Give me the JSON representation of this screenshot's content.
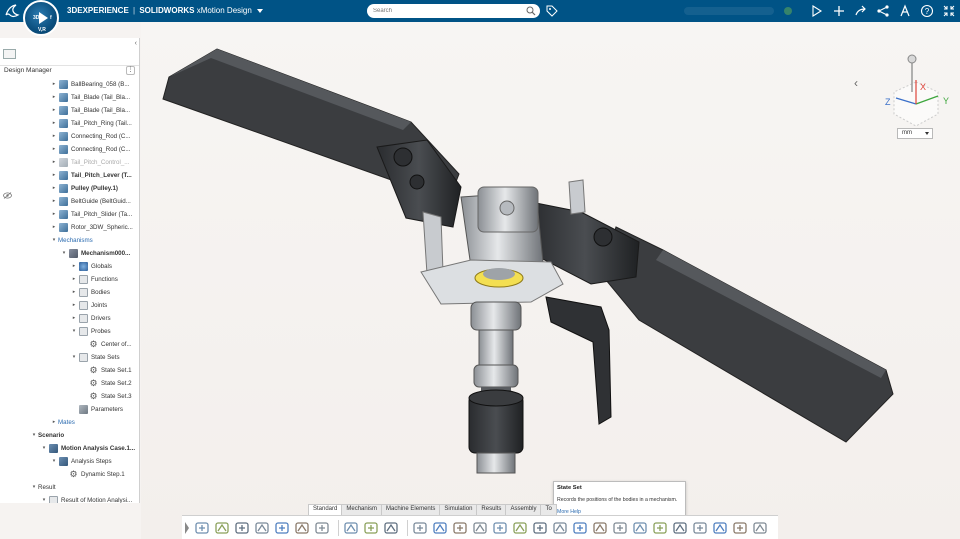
{
  "topbar": {
    "brand_logo": "3ds-logo-icon",
    "compass_play": "play-icon",
    "compass_top": "3D",
    "compass_side": "f",
    "compass_version": "V,R",
    "brand": "3DEXPERIENCE",
    "separator": "|",
    "product": "SOLIDWORKS",
    "app": "xMotion Design",
    "search_placeholder": "Search",
    "icons": [
      "search-icon",
      "tag-icon",
      "share-icon",
      "add-icon",
      "forward-icon",
      "network-icon",
      "compass-tools-icon",
      "help-icon",
      "close-fullscreen-icon"
    ]
  },
  "left_panel": {
    "title": "Design Manager",
    "collapse": "‹",
    "more": "⋮",
    "tree": [
      {
        "label": "BallBearing_058 (B...",
        "indent": 0,
        "icon": "part",
        "arrow": "▸",
        "style": "normal"
      },
      {
        "label": "Tail_Blade (Tail_Bla...",
        "indent": 0,
        "icon": "part",
        "arrow": "▸",
        "style": "normal"
      },
      {
        "label": "Tail_Blade (Tail_Bla...",
        "indent": 0,
        "icon": "part",
        "arrow": "▸",
        "style": "normal"
      },
      {
        "label": "Tail_Pitch_Ring (Tail...",
        "indent": 0,
        "icon": "part",
        "arrow": "▸",
        "style": "normal"
      },
      {
        "label": "Connecting_Rod (C...",
        "indent": 0,
        "icon": "part",
        "arrow": "▸",
        "style": "normal"
      },
      {
        "label": "Connecting_Rod (C...",
        "indent": 0,
        "icon": "part",
        "arrow": "▸",
        "style": "normal"
      },
      {
        "label": "Tail_Pitch_Control_...",
        "indent": 0,
        "icon": "part-grey",
        "arrow": "▸",
        "style": "grey"
      },
      {
        "label": "Tail_Pitch_Lever (T...",
        "indent": 0,
        "icon": "part",
        "arrow": "▸",
        "style": "bold"
      },
      {
        "label": "Pulley (Pulley.1)",
        "indent": 0,
        "icon": "part",
        "arrow": "▸",
        "style": "bold"
      },
      {
        "label": "BeltGuide (BeltGuid...",
        "indent": 0,
        "icon": "part",
        "arrow": "▸",
        "style": "normal"
      },
      {
        "label": "Tail_Pitch_Slider (Ta...",
        "indent": 0,
        "icon": "part",
        "arrow": "▸",
        "style": "normal"
      },
      {
        "label": "Rotor_3DW_Spheric...",
        "indent": 0,
        "icon": "part",
        "arrow": "▸",
        "style": "normal"
      },
      {
        "label": "Mechanisms",
        "indent": 0,
        "icon": "none",
        "arrow": "▾",
        "style": "blue"
      },
      {
        "label": "Mechanism000...",
        "indent": 1,
        "icon": "mech",
        "arrow": "▾",
        "style": "bold"
      },
      {
        "label": "Globals",
        "indent": 2,
        "icon": "globe",
        "arrow": "▸",
        "style": "normal"
      },
      {
        "label": "Functions",
        "indent": 2,
        "icon": "folder",
        "arrow": "▸",
        "style": "normal"
      },
      {
        "label": "Bodies",
        "indent": 2,
        "icon": "folder",
        "arrow": "▸",
        "style": "normal"
      },
      {
        "label": "Joints",
        "indent": 2,
        "icon": "folder",
        "arrow": "▸",
        "style": "normal"
      },
      {
        "label": "Drivers",
        "indent": 2,
        "icon": "folder",
        "arrow": "▸",
        "style": "normal"
      },
      {
        "label": "Probes",
        "indent": 2,
        "icon": "folder",
        "arrow": "▾",
        "style": "normal"
      },
      {
        "label": "Center of...",
        "indent": 3,
        "icon": "state",
        "arrow": "",
        "style": "normal"
      },
      {
        "label": "State Sets",
        "indent": 2,
        "icon": "folder",
        "arrow": "▾",
        "style": "normal"
      },
      {
        "label": "State Set.1",
        "indent": 3,
        "icon": "state",
        "arrow": "",
        "style": "normal"
      },
      {
        "label": "State Set.2",
        "indent": 3,
        "icon": "state",
        "arrow": "",
        "style": "normal"
      },
      {
        "label": "State Set.3",
        "indent": 3,
        "icon": "state",
        "arrow": "",
        "style": "normal"
      },
      {
        "label": "Parameters",
        "indent": 2,
        "icon": "gear",
        "arrow": "",
        "style": "normal"
      },
      {
        "label": "Mates",
        "indent": 0,
        "icon": "none",
        "arrow": "▸",
        "style": "blue"
      },
      {
        "label": "Scenario",
        "indent": -2,
        "icon": "none",
        "arrow": "▾",
        "style": "bold"
      },
      {
        "label": "Motion Analysis Case.1...",
        "indent": -1,
        "icon": "motion",
        "arrow": "▾",
        "style": "bold"
      },
      {
        "label": "Analysis Steps",
        "indent": 0,
        "icon": "motion",
        "arrow": "▾",
        "style": "normal"
      },
      {
        "label": "Dynamic Step.1",
        "indent": 1,
        "icon": "state",
        "arrow": "",
        "style": "normal"
      },
      {
        "label": "Result",
        "indent": -2,
        "icon": "none",
        "arrow": "▾",
        "style": "normal"
      },
      {
        "label": "Result of Motion Analysi...",
        "indent": -1,
        "icon": "folder",
        "arrow": "▾",
        "style": "normal"
      }
    ]
  },
  "viewport": {
    "units": "mm",
    "axes": {
      "x": "X",
      "y": "Y",
      "z": "Z"
    },
    "colors": {
      "x": "#e0443a",
      "y": "#3da63d",
      "z": "#3a6fc9"
    }
  },
  "tooltip": {
    "title": "State Set",
    "text": "Records the positions of the bodies in a mechanism.",
    "link": "More Help"
  },
  "action_bar": {
    "tabs": [
      "Standard",
      "Mechanism",
      "Machine Elements",
      "Simulation",
      "Results",
      "Assembly",
      "To"
    ],
    "active_tab": "Standard",
    "tools": [
      "database-icon",
      "settings-gear-icon",
      "save-icon",
      "save-as-icon",
      "update-icon",
      "capture-icon",
      "options-icon",
      "undo-icon",
      "redo-icon",
      "help-icon",
      "engineering-connection-icon",
      "bodies-icon",
      "box-icon",
      "joint-icon",
      "gear-joint-icon",
      "spring-icon",
      "driver-icon",
      "state-set-icon",
      "probe-icon",
      "sensor-icon",
      "plot-icon",
      "measure-icon",
      "motion-case-icon",
      "step-icon",
      "scenario-a-icon",
      "scenario-b-icon",
      "scenario-c-icon",
      "scenario-d-icon"
    ]
  }
}
